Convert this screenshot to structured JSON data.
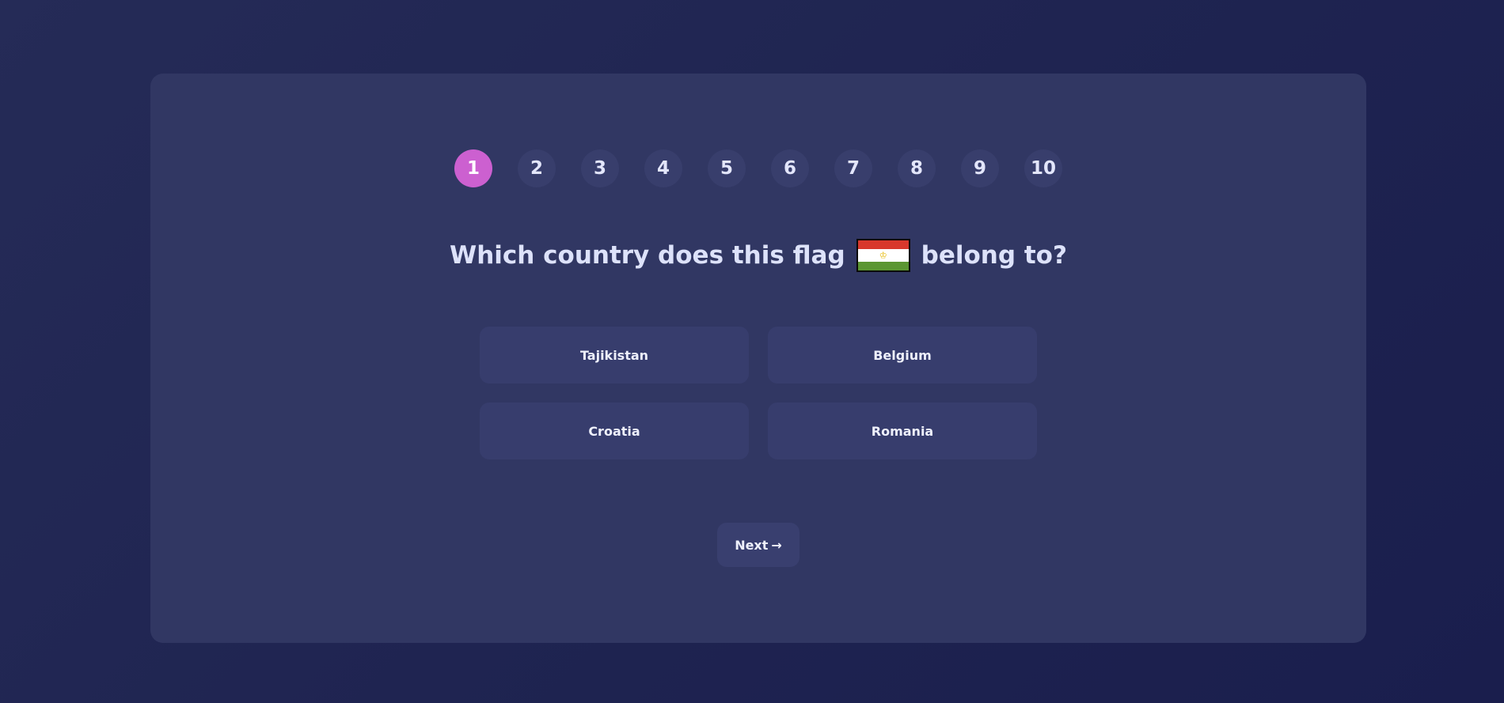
{
  "quiz": {
    "steps": [
      "1",
      "2",
      "3",
      "4",
      "5",
      "6",
      "7",
      "8",
      "9",
      "10"
    ],
    "active_step": "1",
    "question_before": "Which country does this flag",
    "question_after": "belong to?",
    "answers": [
      "Tajikistan",
      "Belgium",
      "Croatia",
      "Romania"
    ],
    "next_label": "Next",
    "next_arrow": "→"
  },
  "colors": {
    "background": "#1f2451",
    "card": "#313763",
    "active_step": "#cc60d0",
    "step": "#383e6c",
    "answer": "#373d6d"
  },
  "icons": {
    "flag": "tajikistan-flag-icon",
    "next": "arrow-right-icon"
  }
}
